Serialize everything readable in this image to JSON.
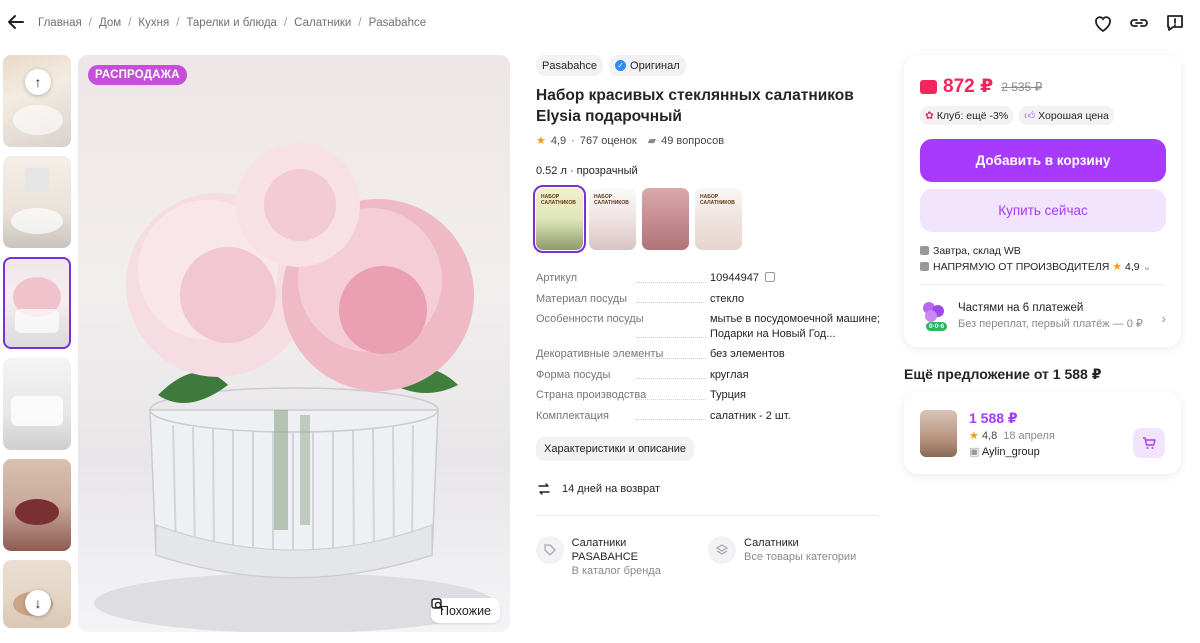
{
  "breadcrumbs": [
    "Главная",
    "Дом",
    "Кухня",
    "Тарелки и блюда",
    "Салатники",
    "Pasabahce"
  ],
  "colors": {
    "accent": "#a73afd",
    "price": "#f2255c",
    "sale_badge": "#c54fd8"
  },
  "gallery": {
    "sale_badge": "РАСПРОДАЖА",
    "similar_label": "Похожие"
  },
  "product": {
    "brand": "Pasabahce",
    "original_label": "Оригинал",
    "title": "Набор красивых стеклянных салатников Elysia подарочный",
    "rating": "4,9",
    "reviews": "767 оценок",
    "questions": "49 вопросов",
    "variant": "0.52 л · прозрачный"
  },
  "specs": [
    {
      "key": "Артикул",
      "value": "10944947"
    },
    {
      "key": "Материал посуды",
      "value": "стекло"
    },
    {
      "key": "Особенности посуды",
      "value": "мытье в посудомоечной машине; Подарки на Новый Год..."
    },
    {
      "key": "Декоративные элементы",
      "value": "без элементов"
    },
    {
      "key": "Форма посуды",
      "value": "круглая"
    },
    {
      "key": "Страна производства",
      "value": "Турция"
    },
    {
      "key": "Комплектация",
      "value": "салатник - 2 шт."
    }
  ],
  "chars_button": "Характеристики и описание",
  "returns": "14 дней на возврат",
  "categories": [
    {
      "title": "Салатники PASABAHCE",
      "sub": "В каталог бренда"
    },
    {
      "title": "Салатники",
      "sub": "Все товары категории"
    }
  ],
  "buybox": {
    "price": "872 ₽",
    "old_price": "2 535 ₽",
    "club_chip": "Клуб: ещё -3%",
    "good_price_chip": "Хорошая цена",
    "add_to_cart": "Добавить в корзину",
    "buy_now": "Купить сейчас",
    "delivery": "Завтра, склад WB",
    "seller": "НАПРЯМУЮ ОТ ПРОИЗВОДИТЕЛЯ",
    "seller_rating": "4,9",
    "installment_badge": "0·0·6",
    "installment_title": "Частями на 6 платежей",
    "installment_sub": "Без переплат, первый платёж — 0 ₽"
  },
  "other_offer": {
    "title": "Ещё предложение от 1 588 ₽",
    "price": "1 588 ₽",
    "rating": "4,8",
    "date": "18 апреля",
    "seller": "Aylin_group"
  }
}
